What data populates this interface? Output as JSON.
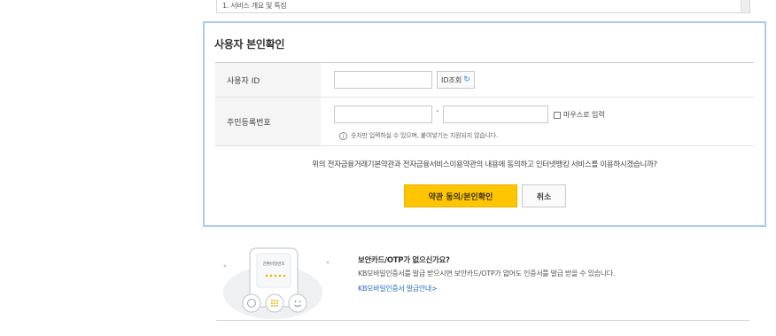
{
  "terms": {
    "section_heading": "1. 서비스 개요 및 특징"
  },
  "auth": {
    "title": "사용자 본인확인",
    "user_id": {
      "label": "사용자 ID",
      "value": "",
      "lookup_button": "ID조회",
      "lookup_icon": "refresh-icon"
    },
    "rrn": {
      "label": "주민등록번호",
      "front_value": "",
      "separator": "-",
      "back_value": "",
      "mouse_input_label": "마우스로 입력",
      "mouse_input_checked": false,
      "hint": "숫자만 입력하실 수 있으며, 붙여넣기는 지원되지 않습니다."
    },
    "agreement_text": "위의 전자금융거래기본약관과 전자금융서비스이용약관의 내용에 동의하고 인터넷뱅킹 서비스를 이용하시겠습니까?",
    "agree_button": "약관 동의/본인확인",
    "cancel_button": "취소"
  },
  "otp_notice": {
    "phone_screen_label": "간편비밀번호",
    "title": "보안카드/OTP가 없으신가요?",
    "description": "KB모바일인증서를 발급 받으시면 보안카드/OTP가 없어도 인증서를 발급 받을 수 있습니다.",
    "link": "KB모바일인증서 발급안내>"
  },
  "colors": {
    "panel_border": "#a9cdee",
    "agree_button_bg": "#ffc600",
    "link": "#2a6dbf"
  }
}
